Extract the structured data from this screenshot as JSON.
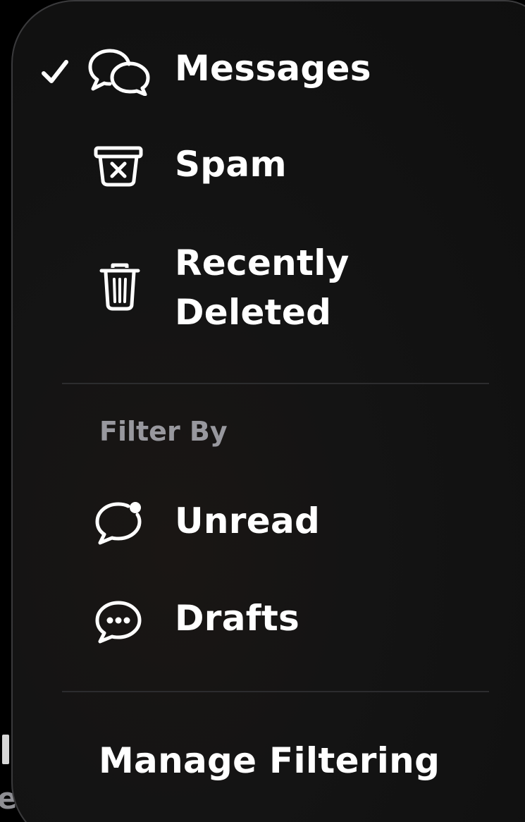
{
  "menu": {
    "items": [
      {
        "label": "Messages",
        "icon": "two-chat-bubbles-icon",
        "checked": true
      },
      {
        "label": "Spam",
        "icon": "junk-bin-icon",
        "checked": false
      },
      {
        "label": "Recently\nDeleted",
        "icon": "trash-icon",
        "checked": false
      }
    ],
    "filter_header": "Filter By",
    "filters": [
      {
        "label": "Unread",
        "icon": "unread-bubble-icon"
      },
      {
        "label": "Drafts",
        "icon": "ellipsis-bubble-icon"
      }
    ],
    "manage_label": "Manage Filtering"
  },
  "background": {
    "edge_text": "e"
  },
  "colors": {
    "menu_bg": "#121212",
    "text": "#ffffff",
    "section_header": "#98989e",
    "divider": "#2c2c2e",
    "border": "#3a3a3c"
  }
}
